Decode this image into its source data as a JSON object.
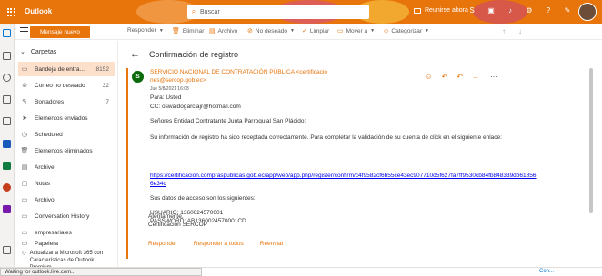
{
  "header": {
    "app_name": "Outlook",
    "search_placeholder": "Buscar",
    "meet_now": "Reunirse ahora"
  },
  "toolbar": {
    "new_mail": "Mensaje nuevo",
    "reply": "Responder",
    "delete": "Eliminar",
    "archive": "Archivo",
    "junk": "No deseado",
    "sweep": "Limpiar",
    "move_to": "Mover a",
    "categorize": "Categorizar"
  },
  "folders": {
    "heading": "Carpetas",
    "items": [
      {
        "label": "Bandeja de entra...",
        "count": "8152"
      },
      {
        "label": "Correo no deseado",
        "count": "32"
      },
      {
        "label": "Borradores",
        "count": "7"
      },
      {
        "label": "Elementos enviados",
        "count": ""
      },
      {
        "label": "Scheduled",
        "count": ""
      },
      {
        "label": "Elementos eliminados",
        "count": ""
      },
      {
        "label": "Archive",
        "count": ""
      },
      {
        "label": "Notas",
        "count": ""
      },
      {
        "label": "Archivo",
        "count": ""
      },
      {
        "label": "Conversation History",
        "count": ""
      },
      {
        "label": "empresariales",
        "count": ""
      },
      {
        "label": "Papelera",
        "count": ""
      }
    ],
    "upgrade": "Actualizar a Microsoft 365 con Características de Outlook Premium"
  },
  "message": {
    "subject": "Confirmación de registro",
    "sender_initial": "S",
    "from": "SERVICIO NACIONAL DE CONTRATACIÓN PÚBLICA <certificacio nes@sercop.gob.ec>",
    "date": "Jue 5/8/2021 16:08",
    "to": "Para:  Usted",
    "cc": "CC:  oswaldogarciajr@hotmail.com",
    "greeting": "Señores Entidad Contratante Junta Parroquial San Plácido:",
    "line1": "Su información de registro ha sido receptada correctamente. Para completar la validación de su cuenta de click en el siguiente enlace:",
    "link": "https://certificacion.compraspublicas.gob.ec/app/web/app.php/register/confirm/c4f9582cf6b55ce43ec907710d5f627fa7ff9530cb84fb848339db618566e34c",
    "line2": "Sus datos de acceso son los siguientes:",
    "user": "USUARIO: 1360024570001",
    "password": "PASSWORD: AB1360024570001CD",
    "sign1": "Atentamente,",
    "sign2": "Certificación SERCOP",
    "reply": "Responder",
    "reply_all": "Responder a todos",
    "forward": "Reenviar"
  },
  "status": {
    "text": "Waiting for outlook.live.com...",
    "credit": "Con..."
  }
}
